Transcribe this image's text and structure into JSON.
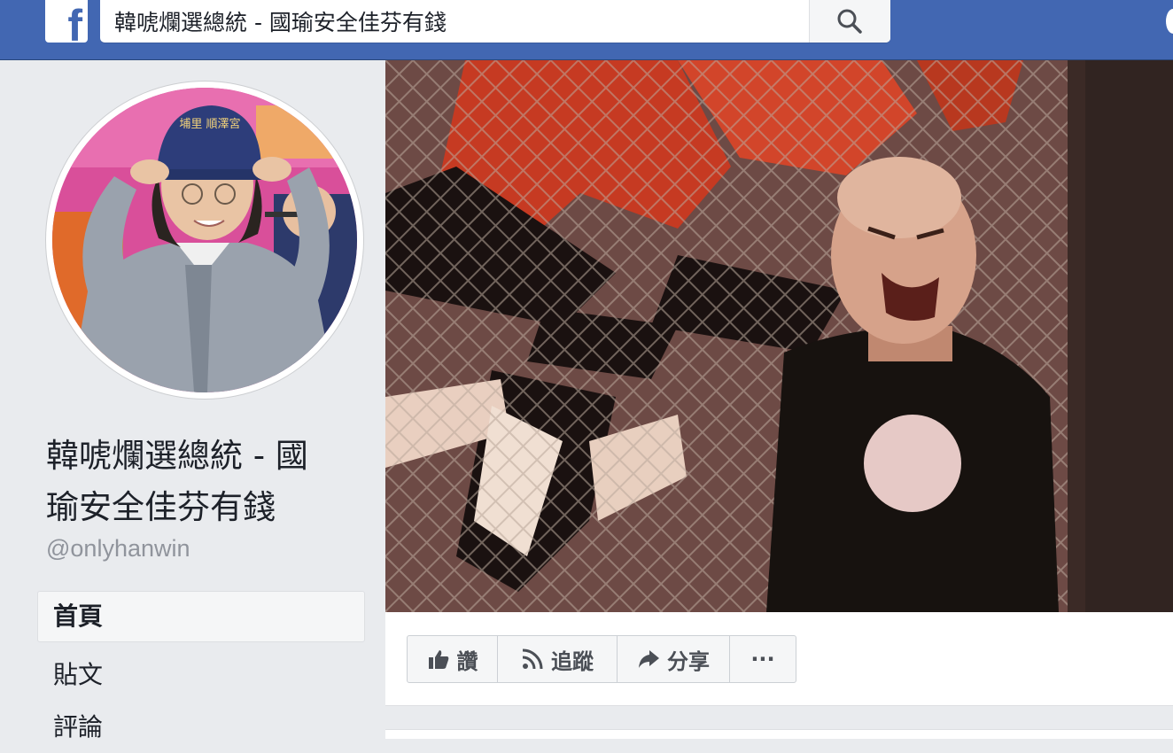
{
  "search": {
    "value": "韓唬爛選總統 - 國瑜安全佳芬有錢"
  },
  "page": {
    "name_line1": "韓唬爛選總統 - 國",
    "name_line2": "瑜安全佳芬有錢",
    "handle": "@onlyhanwin",
    "cap_text": "埔里 順澤宮"
  },
  "nav": {
    "items": [
      {
        "label": "首頁"
      },
      {
        "label": "貼文"
      },
      {
        "label": "評論"
      }
    ]
  },
  "actions": {
    "like": "讚",
    "follow": "追蹤",
    "share": "分享",
    "more": "···"
  },
  "colors": {
    "brand": "#4267b2",
    "background": "#e9ebee"
  }
}
